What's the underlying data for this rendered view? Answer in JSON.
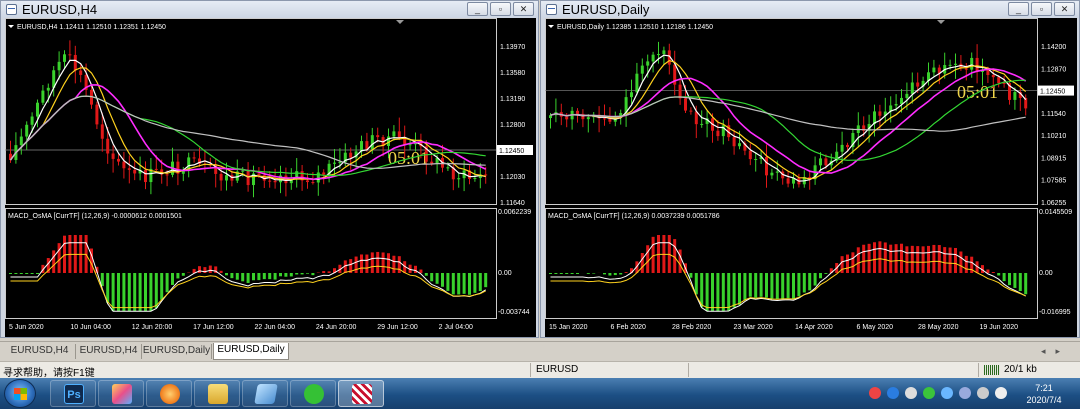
{
  "windows": {
    "left": {
      "title": "EURUSD,H4",
      "header": "EURUSD,H4  1.12411 1.12510 1.12351 1.12450",
      "price_ticks": [
        "1.13970",
        "1.13580",
        "1.13190",
        "1.12800",
        "1.12450",
        "1.12030",
        "1.11640"
      ],
      "current_price": "1.12450",
      "timer": "05:01",
      "macd_header": "MACD_OsMA [CurrTF] (12,26,9) -0.0000612 0.0001501",
      "macd_ticks": [
        "0.0062239",
        "0.00",
        "-0.003744"
      ],
      "time_labels": [
        "5 Jun 2020",
        "10 Jun 04:00",
        "12 Jun 20:00",
        "17 Jun 12:00",
        "22 Jun 04:00",
        "24 Jun 20:00",
        "29 Jun 12:00",
        "2 Jul 04:00"
      ]
    },
    "right": {
      "title": "EURUSD,Daily",
      "header": "EURUSD,Daily  1.12385 1.12510 1.12186 1.12450",
      "price_ticks": [
        "1.14200",
        "1.12870",
        "1.12450",
        "1.11540",
        "1.10210",
        "1.08915",
        "1.07585",
        "1.06255"
      ],
      "current_price": "1.12450",
      "timer": "05:01",
      "macd_header": "MACD_OsMA [CurrTF] (12,26,9) 0.0037239 0.0051786",
      "macd_ticks": [
        "0.0145509",
        "0.00",
        "-0.016995"
      ],
      "time_labels": [
        "15 Jan 2020",
        "6 Feb 2020",
        "28 Feb 2020",
        "23 Mar 2020",
        "14 Apr 2020",
        "6 May 2020",
        "28 May 2020",
        "19 Jun 2020"
      ]
    }
  },
  "window_buttons": {
    "minimize": "_",
    "restore": "▫",
    "close": "✕"
  },
  "tabs": [
    {
      "label": "EURUSD,H4"
    },
    {
      "label": "EURUSD,H4"
    },
    {
      "label": "EURUSD,Daily"
    },
    {
      "label": "EURUSD,Daily",
      "active": true
    }
  ],
  "tab_arrows": "◂▸",
  "status": {
    "help": "寻求帮助，请按F1键",
    "symbol": "EURUSD",
    "traffic": "20/1 kb"
  },
  "taskbar": {
    "apps": [
      {
        "icon": "photoshop-icon",
        "glyph": "Ps"
      },
      {
        "icon": "paint-app-icon",
        "glyph": ""
      },
      {
        "icon": "browser-icon",
        "glyph": ""
      },
      {
        "icon": "folder-icon",
        "glyph": ""
      },
      {
        "icon": "notebook-icon",
        "glyph": ""
      },
      {
        "icon": "wechat-icon",
        "glyph": ""
      },
      {
        "icon": "metatrader-icon",
        "glyph": ""
      }
    ],
    "clock_time": "7:21",
    "clock_date": "2020/7/4"
  },
  "colors": {
    "chart_bg": "#000000",
    "bull": "#39d12c",
    "bear": "#e01818",
    "ma_white": "#ffffff",
    "ma_yellow": "#ffd21e",
    "ma_magenta": "#ff2cff",
    "ma_green": "#33d633",
    "ma_gray": "#c0c0c0",
    "timer_text": "#f0d54a"
  }
}
